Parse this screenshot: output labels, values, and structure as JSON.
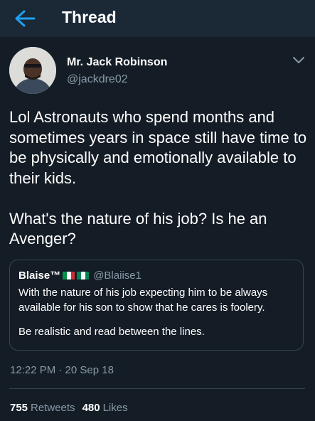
{
  "header": {
    "title": "Thread",
    "back_icon": "arrow-left-icon",
    "accent": "#1da1f2"
  },
  "tweet": {
    "author_name": "Mr. Jack Robinson",
    "author_handle": "@jackdre02",
    "paragraphs": [
      "Lol Astronauts who spend months and sometimes years in space still have time to be physically and emotionally available to their kids.",
      "What's the nature of his job? Is he an Avenger?"
    ],
    "menu_icon": "chevron-down-icon"
  },
  "quoted_tweet": {
    "author_name": "Blaise™",
    "author_handle": "@Blaiise1",
    "flags": [
      "italy-flag",
      "nigeria-flag"
    ],
    "paragraphs": [
      "With the nature of his job expecting him to be always available for his son to show that he cares is foolery.",
      "Be realistic and read between the lines."
    ]
  },
  "meta": {
    "timestamp": "12:22 PM · 20 Sep 18"
  },
  "stats": {
    "retweets_count": "755",
    "retweets_label": "Retweets",
    "likes_count": "480",
    "likes_label": "Likes"
  },
  "colors": {
    "background": "#141d26",
    "header_bg": "#1b2836",
    "secondary_text": "#8899a6",
    "border": "#38444d"
  }
}
